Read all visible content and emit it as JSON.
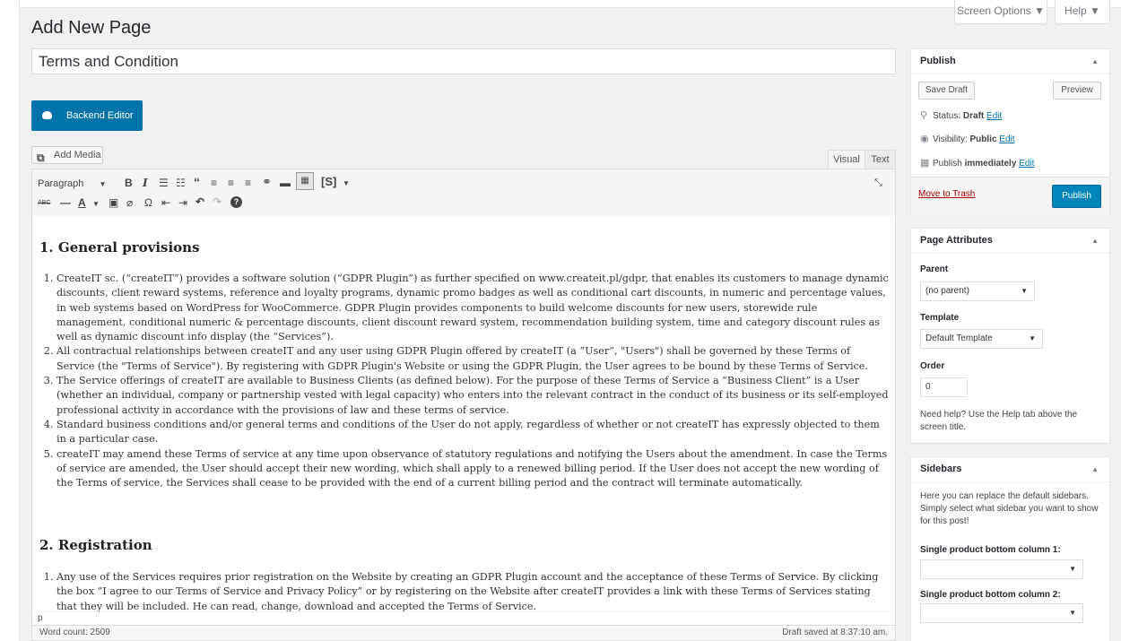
{
  "screen_options": {
    "label": "Screen Options ▼",
    "help": "Help ▼"
  },
  "page_heading": "Add New Page",
  "title_value": "Terms and Condition",
  "backend_editor_label": "Backend Editor",
  "add_media_label": "Add Media",
  "tabs": {
    "visual": "Visual",
    "text": "Text"
  },
  "toolbar": {
    "format_select": "Paragraph"
  },
  "content": {
    "h1": "1. General provisions",
    "list1": [
      "CreateIT sc. (“createIT”) provides a software solution (“GDPR Plugin”) as further specified on www.createit.pl/gdpr, that enables its customers to manage dynamic discounts, client reward systems, reference and loyalty programs, dynamic promo badges as well as conditional cart discounts, in numeric and percentage values, in web systems based on WordPress for WooCommerce. GDPR Plugin provides components to build welcome discounts for new users, storewide rule management, conditional numeric & percentage discounts, client discount reward system, recommendation building system, time and category discount rules as well as dynamic discount info display (the “Services”).",
      "All contractual relationships between createIT and any user using GDPR Plugin offered by createIT (a “User”, \"Users\") shall be governed by these Terms of Service (the \"Terms of Service\"). By registering with GDPR Plugin's Website or using the GDPR Plugin, the User agrees to be bound by these Terms of Service.",
      "The Service offerings of createIT are available to Business Clients (as defined below). For the purpose of these Terms of Service a “Business Client” is a User (whether an individual, company or partnership vested with legal capacity) who enters into the relevant contract in the conduct of its business or its self-employed professional activity in accordance with the provisions of law and these terms of service.",
      "Standard business conditions and/or general terms and conditions of the User do not apply, regardless of whether or not createIT has expressly objected to them in a particular case.",
      "createIT may amend these Terms of service at any time upon observance of statutory regulations and notifying the Users about the amendment. In case the Terms of service are amended, the User should accept their new wording, which shall apply to a renewed billing period. If the User does not accept the new wording of the Terms of service, the Services shall cease to be provided with the end of a current billing period and the contract will terminate automatically."
    ],
    "h2": "2. Registration",
    "list2": [
      "Any use of the Services requires prior registration on the Website by creating an GDPR Plugin account and the acceptance of these Terms of Service. By clicking the box “I agree to our Terms of Service and Privacy Policy” or by registering on the Website after createIT provides a link with these Terms of Services stating that they will be included. He can read, change, download and accepted the Terms of Service."
    ]
  },
  "path_label": "p",
  "word_count": "Word count: 2509",
  "draft_saved": "Draft saved at 8:37:10 am.",
  "publish": {
    "title": "Publish",
    "save_draft": "Save Draft",
    "preview": "Preview",
    "status_label": "Status:",
    "status_value": "Draft",
    "visibility_label": "Visibility:",
    "visibility_value": "Public",
    "publish_label": "Publish",
    "publish_value": "immediately",
    "edit": "Edit",
    "trash": "Move to Trash",
    "publish_button": "Publish"
  },
  "attributes": {
    "title": "Page Attributes",
    "parent_label": "Parent",
    "parent_value": "(no parent)",
    "template_label": "Template",
    "template_value": "Default Template",
    "order_label": "Order",
    "order_value": "0",
    "help": "Need help? Use the Help tab above the screen title."
  },
  "sidebars": {
    "title": "Sidebars",
    "desc": "Here you can replace the default sidebars. Simply select what sidebar you want to show for this post!",
    "col1_label": "Single product bottom column 1:",
    "col2_label": "Single product bottom column 2:"
  },
  "colors": {
    "primary": "#0073aa",
    "link": "#0073aa",
    "trash": "#a00"
  }
}
